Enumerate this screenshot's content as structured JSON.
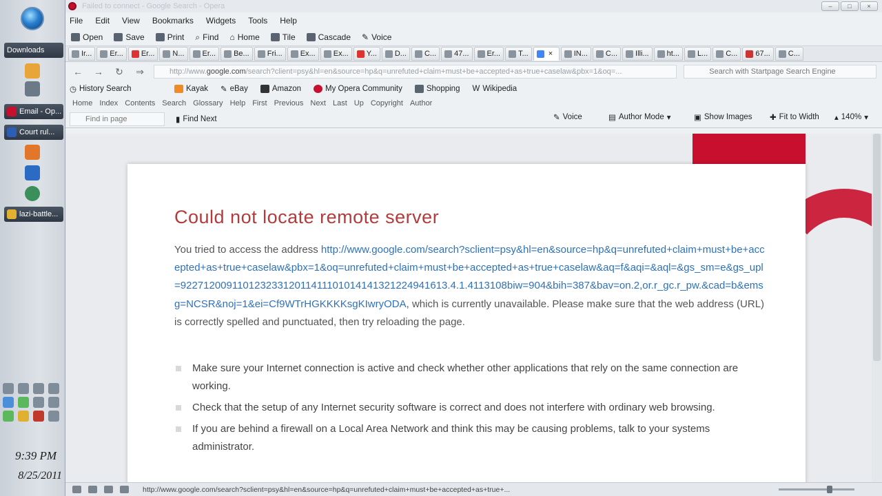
{
  "taskbar": {
    "items": [
      {
        "label": "Downloads",
        "icon": "folder-icon"
      },
      {
        "label": "Email - Op...",
        "icon": "opera-icon"
      },
      {
        "label": "Court rul...",
        "icon": "word-icon"
      },
      {
        "label": "lazi-battle...",
        "icon": "app-icon"
      }
    ],
    "clock_time": "9:39 PM",
    "clock_date": "8/25/2011"
  },
  "browser": {
    "title": "Failed to connect - Google Search - Opera",
    "menu": [
      "File",
      "Edit",
      "View",
      "Bookmarks",
      "Widgets",
      "Tools",
      "Help"
    ],
    "toolbar": [
      "Open",
      "Save",
      "Print",
      "Find",
      "Home",
      "Tile",
      "Cascade",
      "Voice"
    ],
    "tabs": [
      "Ir...",
      "Er...",
      "Er...",
      "N...",
      "Er...",
      "Be...",
      "Fri...",
      "Ex...",
      "Ex...",
      "Y...",
      "D...",
      "C...",
      "47...",
      "Er...",
      "T...",
      "",
      "IN...",
      "C...",
      "Illi...",
      "ht...",
      "L...",
      "C...",
      "67...",
      "C..."
    ],
    "address": {
      "prefix": "http://www.",
      "domain": "google.com",
      "rest": "/search?client=psy&hl=en&source=hp&q=unrefuted+claim+must+be+accepted+as+true+caselaw&pbx=1&oq=..."
    },
    "search_placeholder": "Search with Startpage Search Engine",
    "bookmarks": [
      "History Search",
      "Kayak",
      "eBay",
      "Amazon",
      "My Opera Community",
      "Shopping",
      "Wikipedia"
    ],
    "navbar": [
      "Home",
      "Index",
      "Contents",
      "Search",
      "Glossary",
      "Help",
      "First",
      "Previous",
      "Next",
      "Last",
      "Up",
      "Copyright",
      "Author"
    ],
    "find_placeholder": "Find in page",
    "find_next": "Find Next",
    "voice": "Voice",
    "author_mode": "Author Mode",
    "show_images": "Show Images",
    "fit_to_width": "Fit to Width",
    "zoom": "140%"
  },
  "error": {
    "title": "Could not locate remote server",
    "para_prefix": "You tried to access the address ",
    "url": "http://www.google.com/search?sclient=psy&hl=en&source=hp&q=unrefuted+claim+must+be+accepted+as+true+caselaw&pbx=1&oq=unrefuted+claim+must+be+accepted+as+true+caselaw&aq=f&aqi=&aql=&gs_sm=e&gs_upl=92271200911012323312011411101014141321224941613.4.1.4113108biw=904&bih=387&bav=on.2,or.r_gc.r_pw.&cad=b&emsg=NCSR&noj=1&ei=Cf9WTrHGKKKKsgKIwryODA",
    "para_suffix": ", which is currently unavailable. Please make sure that the web address (URL) is correctly spelled and punctuated, then try reloading the page.",
    "tips": [
      "Make sure your Internet connection is active and check whether other applications that rely on the same connection are working.",
      "Check that the setup of any Internet security software is correct and does not interfere with ordinary web browsing.",
      "If you are behind a firewall on a Local Area Network and think this may be causing problems, talk to your systems administrator."
    ]
  },
  "status": {
    "url": "http://www.google.com/search?sclient=psy&hl=en&source=hp&q=unrefuted+claim+must+be+accepted+as+true+..."
  },
  "colors": {
    "opera_red": "#c8102e",
    "link": "#2f71b8",
    "error_title": "#b23b3b"
  }
}
